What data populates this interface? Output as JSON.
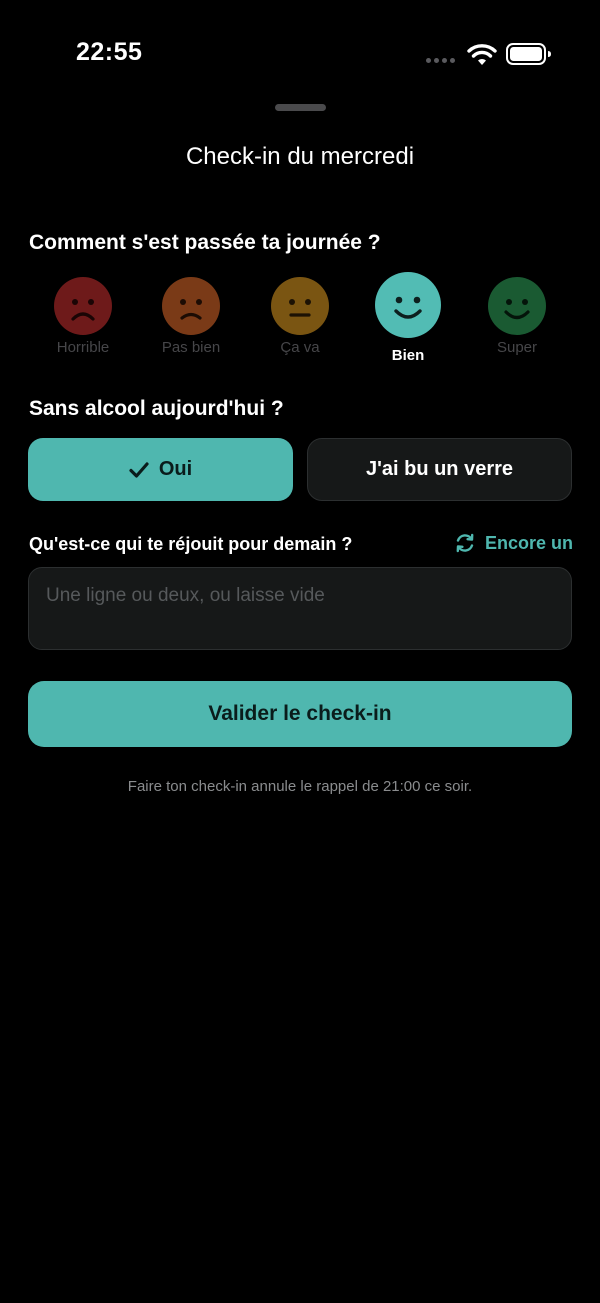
{
  "status_bar": {
    "time": "22:55"
  },
  "sheet": {
    "title": "Check-in du mercredi"
  },
  "mood_question": "Comment s'est passée ta journée ?",
  "moods": [
    {
      "label": "Horrible",
      "face": "frown-face-icon",
      "color": "#6e1a1a",
      "selected": false
    },
    {
      "label": "Pas bien",
      "face": "frown-face-icon",
      "color": "#7a3a17",
      "selected": false
    },
    {
      "label": "Ça va",
      "face": "neutral-face-icon",
      "color": "#7a5512",
      "selected": false
    },
    {
      "label": "Bien",
      "face": "smile-face-icon",
      "color": "#52bcb4",
      "selected": true
    },
    {
      "label": "Super",
      "face": "smile-face-icon",
      "color": "#1a5a32",
      "selected": false
    }
  ],
  "alcohol_question": "Sans alcool aujourd'hui ?",
  "alcohol_options": {
    "yes_label": "Oui",
    "no_label": "J'ai bu un verre",
    "selected": "yes"
  },
  "joy_question": "Qu'est-ce qui te réjouit pour demain ?",
  "refresh_label": "Encore un",
  "joy_input": {
    "placeholder": "Une ligne ou deux, ou laisse vide",
    "value": ""
  },
  "submit_label": "Valider le check-in",
  "footnote": "Faire ton check-in annule le rappel de 21:00 ce soir.",
  "colors": {
    "accent": "#4fb7af",
    "background": "#000000",
    "surface": "#161818"
  }
}
